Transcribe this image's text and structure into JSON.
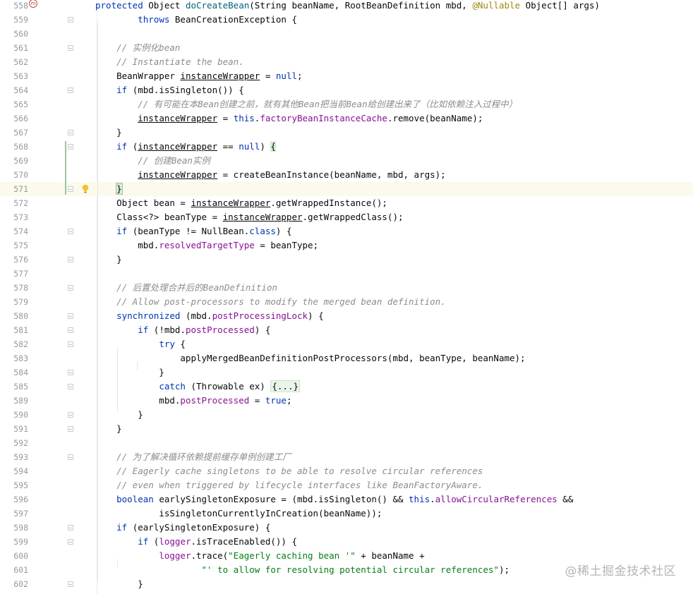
{
  "editor": {
    "current_line_number": "571",
    "lines": [
      {
        "n": "558",
        "segs": [
          [
            "kw",
            "protected "
          ],
          [
            "",
            "Object "
          ],
          [
            "mth",
            "doCreateBean"
          ],
          [
            "",
            "(String beanName, RootBeanDefinition mbd, "
          ],
          [
            "ann",
            "@Nullable"
          ],
          [
            "",
            " Object[] args)"
          ]
        ]
      },
      {
        "n": "559",
        "segs": [
          [
            "",
            "        "
          ],
          [
            "kw",
            "throws"
          ],
          [
            "",
            " BeanCreationException {"
          ]
        ]
      },
      {
        "n": "560",
        "segs": []
      },
      {
        "n": "561",
        "segs": [
          [
            "",
            "    "
          ],
          [
            "cm",
            "// 实例化bean"
          ]
        ]
      },
      {
        "n": "562",
        "segs": [
          [
            "",
            "    "
          ],
          [
            "cm",
            "// Instantiate the bean."
          ]
        ]
      },
      {
        "n": "563",
        "segs": [
          [
            "",
            "    BeanWrapper "
          ],
          [
            "ul",
            "instanceWrapper"
          ],
          [
            "",
            " = "
          ],
          [
            "kw",
            "null"
          ],
          [
            "",
            ";"
          ]
        ]
      },
      {
        "n": "564",
        "segs": [
          [
            "",
            "    "
          ],
          [
            "kw",
            "if"
          ],
          [
            "",
            " (mbd.isSingleton()) {"
          ]
        ]
      },
      {
        "n": "565",
        "segs": [
          [
            "",
            "        "
          ],
          [
            "cm",
            "// 有可能在本Bean创建之前，就有其他Bean把当前Bean给创建出来了（比如依赖注入过程中）"
          ]
        ]
      },
      {
        "n": "566",
        "segs": [
          [
            "",
            "        "
          ],
          [
            "ul",
            "instanceWrapper"
          ],
          [
            "",
            " = "
          ],
          [
            "kw",
            "this"
          ],
          [
            "",
            "."
          ],
          [
            "fld",
            "factoryBeanInstanceCache"
          ],
          [
            "",
            ".remove(beanName);"
          ]
        ]
      },
      {
        "n": "567",
        "segs": [
          [
            "",
            "    }"
          ]
        ]
      },
      {
        "n": "568",
        "segs": [
          [
            "",
            "    "
          ],
          [
            "kw",
            "if"
          ],
          [
            "",
            " ("
          ],
          [
            "ul",
            "instanceWrapper"
          ],
          [
            "",
            " == "
          ],
          [
            "kw",
            "null"
          ],
          [
            "",
            ") "
          ],
          [
            "brace-hl",
            "{"
          ]
        ]
      },
      {
        "n": "569",
        "segs": [
          [
            "",
            "        "
          ],
          [
            "cm",
            "// 创建Bean实例"
          ]
        ]
      },
      {
        "n": "570",
        "segs": [
          [
            "",
            "        "
          ],
          [
            "ul",
            "instanceWrapper"
          ],
          [
            "",
            " = createBeanInstance(beanName, mbd, args);"
          ]
        ]
      },
      {
        "n": "571",
        "segs": [
          [
            "",
            "    "
          ],
          [
            "brace-hl2",
            "}"
          ]
        ]
      },
      {
        "n": "572",
        "segs": [
          [
            "",
            "    Object bean = "
          ],
          [
            "ul",
            "instanceWrapper"
          ],
          [
            "",
            ".getWrappedInstance();"
          ]
        ]
      },
      {
        "n": "573",
        "segs": [
          [
            "",
            "    Class<?> beanType = "
          ],
          [
            "ul",
            "instanceWrapper"
          ],
          [
            "",
            ".getWrappedClass();"
          ]
        ]
      },
      {
        "n": "574",
        "segs": [
          [
            "",
            "    "
          ],
          [
            "kw",
            "if"
          ],
          [
            "",
            " (beanType != NullBean."
          ],
          [
            "kw",
            "class"
          ],
          [
            "",
            ") {"
          ]
        ]
      },
      {
        "n": "575",
        "segs": [
          [
            "",
            "        mbd."
          ],
          [
            "fld",
            "resolvedTargetType"
          ],
          [
            "",
            " = beanType;"
          ]
        ]
      },
      {
        "n": "576",
        "segs": [
          [
            "",
            "    }"
          ]
        ]
      },
      {
        "n": "577",
        "segs": []
      },
      {
        "n": "578",
        "segs": [
          [
            "",
            "    "
          ],
          [
            "cm",
            "// 后置处理合并后的BeanDefinition"
          ]
        ]
      },
      {
        "n": "579",
        "segs": [
          [
            "",
            "    "
          ],
          [
            "cm",
            "// Allow post-processors to modify the merged bean definition."
          ]
        ]
      },
      {
        "n": "580",
        "segs": [
          [
            "",
            "    "
          ],
          [
            "kw",
            "synchronized"
          ],
          [
            "",
            " (mbd."
          ],
          [
            "fld",
            "postProcessingLock"
          ],
          [
            "",
            ") {"
          ]
        ]
      },
      {
        "n": "581",
        "segs": [
          [
            "",
            "        "
          ],
          [
            "kw",
            "if"
          ],
          [
            "",
            " (!mbd."
          ],
          [
            "fld",
            "postProcessed"
          ],
          [
            "",
            ") {"
          ]
        ]
      },
      {
        "n": "582",
        "segs": [
          [
            "",
            "            "
          ],
          [
            "kw",
            "try"
          ],
          [
            "",
            " {"
          ]
        ]
      },
      {
        "n": "583",
        "segs": [
          [
            "",
            "                applyMergedBeanDefinitionPostProcessors(mbd, beanType, beanName);"
          ]
        ]
      },
      {
        "n": "584",
        "segs": [
          [
            "",
            "            }"
          ]
        ]
      },
      {
        "n": "585",
        "segs": [
          [
            "",
            "            "
          ],
          [
            "kw",
            "catch"
          ],
          [
            "",
            " (Throwable ex) "
          ],
          [
            "fold-region",
            "{...}"
          ]
        ]
      },
      {
        "n": "589",
        "segs": [
          [
            "",
            "            mbd."
          ],
          [
            "fld",
            "postProcessed"
          ],
          [
            "",
            " = "
          ],
          [
            "kw",
            "true"
          ],
          [
            "",
            ";"
          ]
        ]
      },
      {
        "n": "590",
        "segs": [
          [
            "",
            "        }"
          ]
        ]
      },
      {
        "n": "591",
        "segs": [
          [
            "",
            "    }"
          ]
        ]
      },
      {
        "n": "592",
        "segs": []
      },
      {
        "n": "593",
        "segs": [
          [
            "",
            "    "
          ],
          [
            "cm",
            "// 为了解决循环依赖提前缓存单例创建工厂"
          ]
        ]
      },
      {
        "n": "594",
        "segs": [
          [
            "",
            "    "
          ],
          [
            "cm",
            "// Eagerly cache singletons to be able to resolve circular references"
          ]
        ]
      },
      {
        "n": "595",
        "segs": [
          [
            "",
            "    "
          ],
          [
            "cm",
            "// even when triggered by lifecycle interfaces like BeanFactoryAware."
          ]
        ]
      },
      {
        "n": "596",
        "segs": [
          [
            "",
            "    "
          ],
          [
            "kw",
            "boolean"
          ],
          [
            "",
            " earlySingletonExposure = (mbd.isSingleton() && "
          ],
          [
            "kw",
            "this"
          ],
          [
            "",
            "."
          ],
          [
            "fld",
            "allowCircularReferences"
          ],
          [
            "",
            " &&"
          ]
        ]
      },
      {
        "n": "597",
        "segs": [
          [
            "",
            "            isSingletonCurrentlyInCreation(beanName));"
          ]
        ]
      },
      {
        "n": "598",
        "segs": [
          [
            "",
            "    "
          ],
          [
            "kw",
            "if"
          ],
          [
            "",
            " (earlySingletonExposure) {"
          ]
        ]
      },
      {
        "n": "599",
        "segs": [
          [
            "",
            "        "
          ],
          [
            "kw",
            "if"
          ],
          [
            "",
            " ("
          ],
          [
            "fld",
            "logger"
          ],
          [
            "",
            ".isTraceEnabled()) {"
          ]
        ]
      },
      {
        "n": "600",
        "segs": [
          [
            "",
            "            "
          ],
          [
            "fld",
            "logger"
          ],
          [
            "",
            ".trace("
          ],
          [
            "str",
            "\"Eagerly caching bean '\""
          ],
          [
            "",
            " + beanName +"
          ]
        ]
      },
      {
        "n": "601",
        "segs": [
          [
            "",
            "                    "
          ],
          [
            "str",
            "\"' to allow for resolving potential circular references\""
          ],
          [
            "",
            ");"
          ]
        ]
      },
      {
        "n": "602",
        "segs": [
          [
            "",
            "        }"
          ]
        ]
      }
    ]
  },
  "watermark": "@稀土掘金技术社区",
  "colors": {
    "keyword": "#0033b3",
    "comment": "#8c8c8c",
    "field": "#871094",
    "method": "#00627a",
    "string": "#067d17",
    "annotation": "#9e880d",
    "current_line_bg": "#fcfaed"
  }
}
